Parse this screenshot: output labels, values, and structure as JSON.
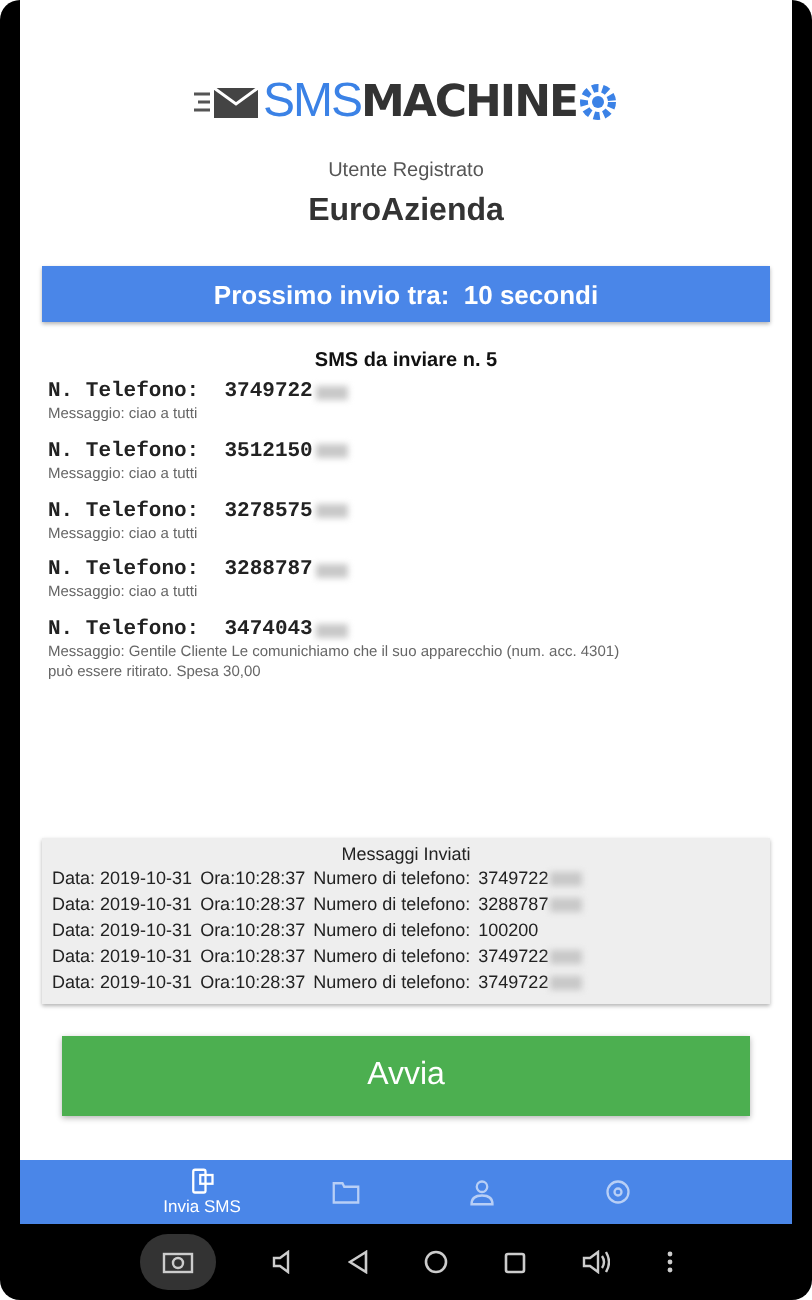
{
  "logo": {
    "part_1": "SMS",
    "part_2": "MACHINE"
  },
  "user": {
    "label": "Utente Registrato",
    "name": "EuroAzienda"
  },
  "countdown": "Prossimo invio tra:  10 secondi",
  "queue": {
    "title": "SMS da inviare n. 5",
    "items": [
      {
        "phone_label": "N. Telefono:",
        "phone": "3749722",
        "message": "Messaggio: ciao a tutti"
      },
      {
        "phone_label": "N. Telefono:",
        "phone": "3512150",
        "message": "Messaggio: ciao a tutti"
      },
      {
        "phone_label": "N. Telefono:",
        "phone": "3278575",
        "message": "Messaggio: ciao a tutti"
      },
      {
        "phone_label": "N. Telefono:",
        "phone": "3288787",
        "message": "Messaggio: ciao a tutti"
      },
      {
        "phone_label": "N. Telefono:",
        "phone": "3474043",
        "message": "Messaggio: Gentile Cliente Le comunichiamo che il suo apparecchio (num. acc. 4301) può essere ritirato. Spesa 30,00"
      }
    ]
  },
  "sent": {
    "title": "Messaggi Inviati",
    "rows": [
      {
        "date": "Data: 2019-10-31",
        "time": "Ora:10:28:37",
        "phone_label": "Numero di telefono:",
        "phone": "3749722",
        "redacted": true
      },
      {
        "date": "Data: 2019-10-31",
        "time": "Ora:10:28:37",
        "phone_label": "Numero di telefono:",
        "phone": "3288787",
        "redacted": true
      },
      {
        "date": "Data: 2019-10-31",
        "time": "Ora:10:28:37",
        "phone_label": "Numero di telefono:",
        "phone": "100200",
        "redacted": false
      },
      {
        "date": "Data: 2019-10-31",
        "time": "Ora:10:28:37",
        "phone_label": "Numero di telefono:",
        "phone": "3749722",
        "redacted": true
      },
      {
        "date": "Data: 2019-10-31",
        "time": "Ora:10:28:37",
        "phone_label": "Numero di telefono:",
        "phone": "3749722",
        "redacted": true
      }
    ]
  },
  "start_button": "Avvia",
  "bottom_nav": [
    {
      "kind": "sms",
      "label": "Invia SMS",
      "selected": true
    },
    {
      "kind": "folder",
      "selected": false
    },
    {
      "kind": "user",
      "selected": false
    },
    {
      "kind": "settings",
      "selected": false
    }
  ]
}
